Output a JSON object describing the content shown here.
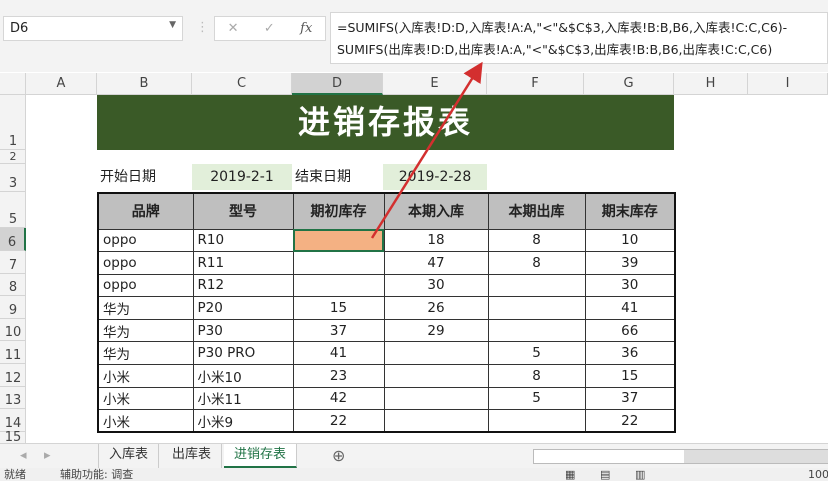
{
  "name_box": "D6",
  "formula_bar": {
    "fx_label": "fx",
    "formula_line1": "=SUMIFS(入库表!D:D,入库表!A:A,\"<\"&$C$3,入库表!B:B,B6,入库表!C:C,C6)-",
    "formula_line2": "SUMIFS(出库表!D:D,出库表!A:A,\"<\"&$C$3,出库表!B:B,B6,出库表!C:C,C6)"
  },
  "columns": [
    "A",
    "B",
    "C",
    "D",
    "E",
    "F",
    "G",
    "H",
    "I"
  ],
  "rows": [
    "1",
    "2",
    "3",
    "5",
    "6",
    "7",
    "8",
    "9",
    "10",
    "11",
    "12",
    "13",
    "14",
    "15"
  ],
  "title": "进销存报表",
  "start_label": "开始日期",
  "start_date": "2019-2-1",
  "end_label": "结束日期",
  "end_date": "2019-2-28",
  "table": {
    "headers": [
      "品牌",
      "型号",
      "期初库存",
      "本期入库",
      "本期出库",
      "期末库存"
    ],
    "rows": [
      [
        "oppo",
        "R10",
        "",
        "18",
        "8",
        "10"
      ],
      [
        "oppo",
        "R11",
        "",
        "47",
        "8",
        "39"
      ],
      [
        "oppo",
        "R12",
        "",
        "30",
        "",
        "30"
      ],
      [
        "华为",
        "P20",
        "15",
        "26",
        "",
        "41"
      ],
      [
        "华为",
        "P30",
        "37",
        "29",
        "",
        "66"
      ],
      [
        "华为",
        "P30 PRO",
        "41",
        "",
        "5",
        "36"
      ],
      [
        "小米",
        "小米10",
        "23",
        "",
        "8",
        "15"
      ],
      [
        "小米",
        "小米11",
        "42",
        "",
        "5",
        "37"
      ],
      [
        "小米",
        "小米9",
        "22",
        "",
        "",
        "22"
      ]
    ]
  },
  "sheet_tabs": [
    "入库表",
    "出库表",
    "进销存表"
  ],
  "active_tab": "进销存表",
  "status": {
    "ready": "就绪",
    "accessibility": "辅助功能: 调查",
    "zoom": "100"
  },
  "colors": {
    "title_bg": "#3a5a27",
    "selected_cell": "#f4b183",
    "date_bg": "#e2efda",
    "header_bg": "#bfbfbf",
    "arrow": "#d32f2f"
  }
}
